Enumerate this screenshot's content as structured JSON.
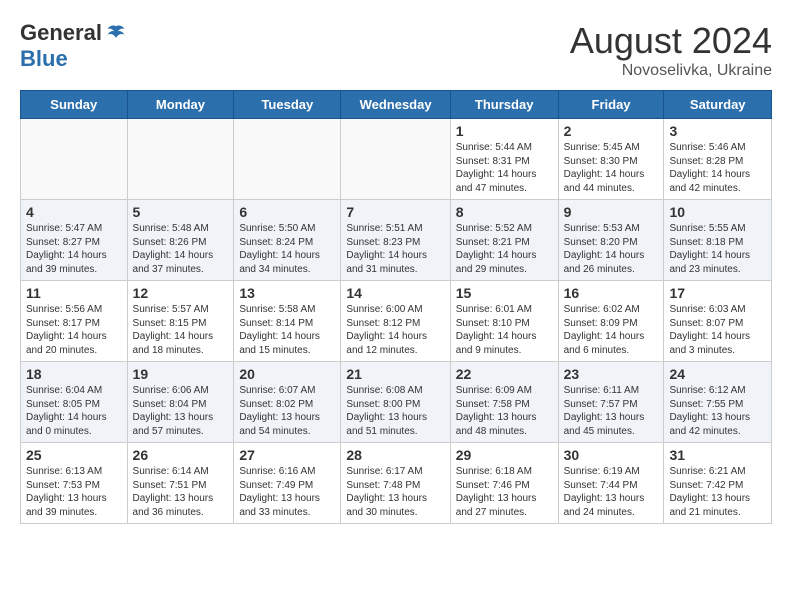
{
  "header": {
    "logo_general": "General",
    "logo_blue": "Blue",
    "month_year": "August 2024",
    "location": "Novoselivka, Ukraine"
  },
  "days_of_week": [
    "Sunday",
    "Monday",
    "Tuesday",
    "Wednesday",
    "Thursday",
    "Friday",
    "Saturday"
  ],
  "weeks": [
    [
      {
        "day": "",
        "info": ""
      },
      {
        "day": "",
        "info": ""
      },
      {
        "day": "",
        "info": ""
      },
      {
        "day": "",
        "info": ""
      },
      {
        "day": "1",
        "info": "Sunrise: 5:44 AM\nSunset: 8:31 PM\nDaylight: 14 hours\nand 47 minutes."
      },
      {
        "day": "2",
        "info": "Sunrise: 5:45 AM\nSunset: 8:30 PM\nDaylight: 14 hours\nand 44 minutes."
      },
      {
        "day": "3",
        "info": "Sunrise: 5:46 AM\nSunset: 8:28 PM\nDaylight: 14 hours\nand 42 minutes."
      }
    ],
    [
      {
        "day": "4",
        "info": "Sunrise: 5:47 AM\nSunset: 8:27 PM\nDaylight: 14 hours\nand 39 minutes."
      },
      {
        "day": "5",
        "info": "Sunrise: 5:48 AM\nSunset: 8:26 PM\nDaylight: 14 hours\nand 37 minutes."
      },
      {
        "day": "6",
        "info": "Sunrise: 5:50 AM\nSunset: 8:24 PM\nDaylight: 14 hours\nand 34 minutes."
      },
      {
        "day": "7",
        "info": "Sunrise: 5:51 AM\nSunset: 8:23 PM\nDaylight: 14 hours\nand 31 minutes."
      },
      {
        "day": "8",
        "info": "Sunrise: 5:52 AM\nSunset: 8:21 PM\nDaylight: 14 hours\nand 29 minutes."
      },
      {
        "day": "9",
        "info": "Sunrise: 5:53 AM\nSunset: 8:20 PM\nDaylight: 14 hours\nand 26 minutes."
      },
      {
        "day": "10",
        "info": "Sunrise: 5:55 AM\nSunset: 8:18 PM\nDaylight: 14 hours\nand 23 minutes."
      }
    ],
    [
      {
        "day": "11",
        "info": "Sunrise: 5:56 AM\nSunset: 8:17 PM\nDaylight: 14 hours\nand 20 minutes."
      },
      {
        "day": "12",
        "info": "Sunrise: 5:57 AM\nSunset: 8:15 PM\nDaylight: 14 hours\nand 18 minutes."
      },
      {
        "day": "13",
        "info": "Sunrise: 5:58 AM\nSunset: 8:14 PM\nDaylight: 14 hours\nand 15 minutes."
      },
      {
        "day": "14",
        "info": "Sunrise: 6:00 AM\nSunset: 8:12 PM\nDaylight: 14 hours\nand 12 minutes."
      },
      {
        "day": "15",
        "info": "Sunrise: 6:01 AM\nSunset: 8:10 PM\nDaylight: 14 hours\nand 9 minutes."
      },
      {
        "day": "16",
        "info": "Sunrise: 6:02 AM\nSunset: 8:09 PM\nDaylight: 14 hours\nand 6 minutes."
      },
      {
        "day": "17",
        "info": "Sunrise: 6:03 AM\nSunset: 8:07 PM\nDaylight: 14 hours\nand 3 minutes."
      }
    ],
    [
      {
        "day": "18",
        "info": "Sunrise: 6:04 AM\nSunset: 8:05 PM\nDaylight: 14 hours\nand 0 minutes."
      },
      {
        "day": "19",
        "info": "Sunrise: 6:06 AM\nSunset: 8:04 PM\nDaylight: 13 hours\nand 57 minutes."
      },
      {
        "day": "20",
        "info": "Sunrise: 6:07 AM\nSunset: 8:02 PM\nDaylight: 13 hours\nand 54 minutes."
      },
      {
        "day": "21",
        "info": "Sunrise: 6:08 AM\nSunset: 8:00 PM\nDaylight: 13 hours\nand 51 minutes."
      },
      {
        "day": "22",
        "info": "Sunrise: 6:09 AM\nSunset: 7:58 PM\nDaylight: 13 hours\nand 48 minutes."
      },
      {
        "day": "23",
        "info": "Sunrise: 6:11 AM\nSunset: 7:57 PM\nDaylight: 13 hours\nand 45 minutes."
      },
      {
        "day": "24",
        "info": "Sunrise: 6:12 AM\nSunset: 7:55 PM\nDaylight: 13 hours\nand 42 minutes."
      }
    ],
    [
      {
        "day": "25",
        "info": "Sunrise: 6:13 AM\nSunset: 7:53 PM\nDaylight: 13 hours\nand 39 minutes."
      },
      {
        "day": "26",
        "info": "Sunrise: 6:14 AM\nSunset: 7:51 PM\nDaylight: 13 hours\nand 36 minutes."
      },
      {
        "day": "27",
        "info": "Sunrise: 6:16 AM\nSunset: 7:49 PM\nDaylight: 13 hours\nand 33 minutes."
      },
      {
        "day": "28",
        "info": "Sunrise: 6:17 AM\nSunset: 7:48 PM\nDaylight: 13 hours\nand 30 minutes."
      },
      {
        "day": "29",
        "info": "Sunrise: 6:18 AM\nSunset: 7:46 PM\nDaylight: 13 hours\nand 27 minutes."
      },
      {
        "day": "30",
        "info": "Sunrise: 6:19 AM\nSunset: 7:44 PM\nDaylight: 13 hours\nand 24 minutes."
      },
      {
        "day": "31",
        "info": "Sunrise: 6:21 AM\nSunset: 7:42 PM\nDaylight: 13 hours\nand 21 minutes."
      }
    ]
  ]
}
